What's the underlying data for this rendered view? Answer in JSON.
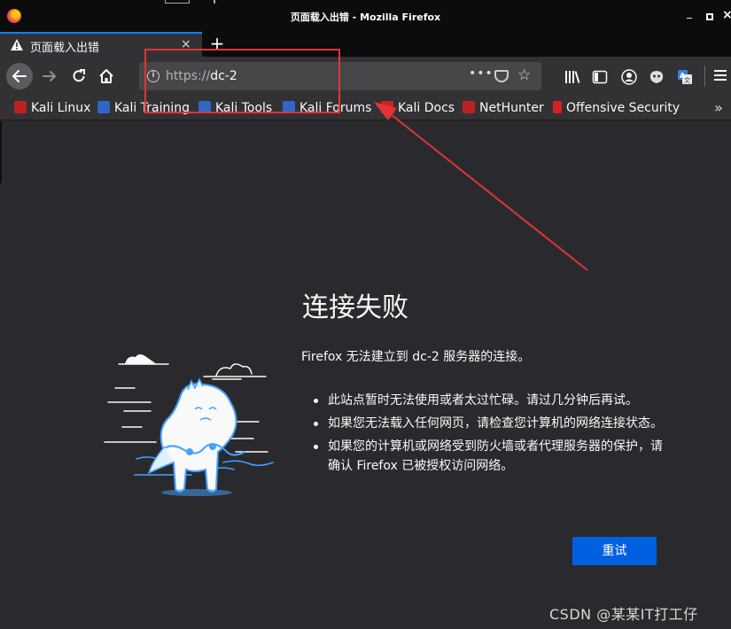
{
  "window": {
    "title": "页面载入出错 - Mozilla Firefox"
  },
  "tab": {
    "label": "页面载入出错",
    "close": "×",
    "new_tab": "+"
  },
  "navbar": {
    "url_protocol": "https://",
    "url_host": "dc-2",
    "more": "•••"
  },
  "bookmarks": [
    {
      "label": "Kali Linux",
      "icon": "kali-icon"
    },
    {
      "label": "Kali Training",
      "icon": "kali-training-icon"
    },
    {
      "label": "Kali Tools",
      "icon": "kali-tools-icon"
    },
    {
      "label": "Kali Forums",
      "icon": "kali-forums-icon"
    },
    {
      "label": "Kali Docs",
      "icon": "kali-docs-icon"
    },
    {
      "label": "NetHunter",
      "icon": "nethunter-icon"
    },
    {
      "label": "Offensive Security",
      "icon": "offsec-icon"
    }
  ],
  "error": {
    "title": "连接失败",
    "description": "Firefox 无法建立到 dc-2 服务器的连接。",
    "bullets": [
      "此站点暂时无法使用或者太过忙碌。请过几分钟后再试。",
      "如果您无法载入任何网页，请检查您计算机的网络连接状态。",
      "如果您的计算机或网络受到防火墙或者代理服务器的保护，请确认 Firefox 已被授权访问网络。"
    ],
    "retry_label": "重试"
  },
  "watermark": "CSDN @某某IT打工仔",
  "colors": {
    "accent": "#0060df",
    "annotation": "#e03535",
    "background": "#2a2a2e"
  }
}
